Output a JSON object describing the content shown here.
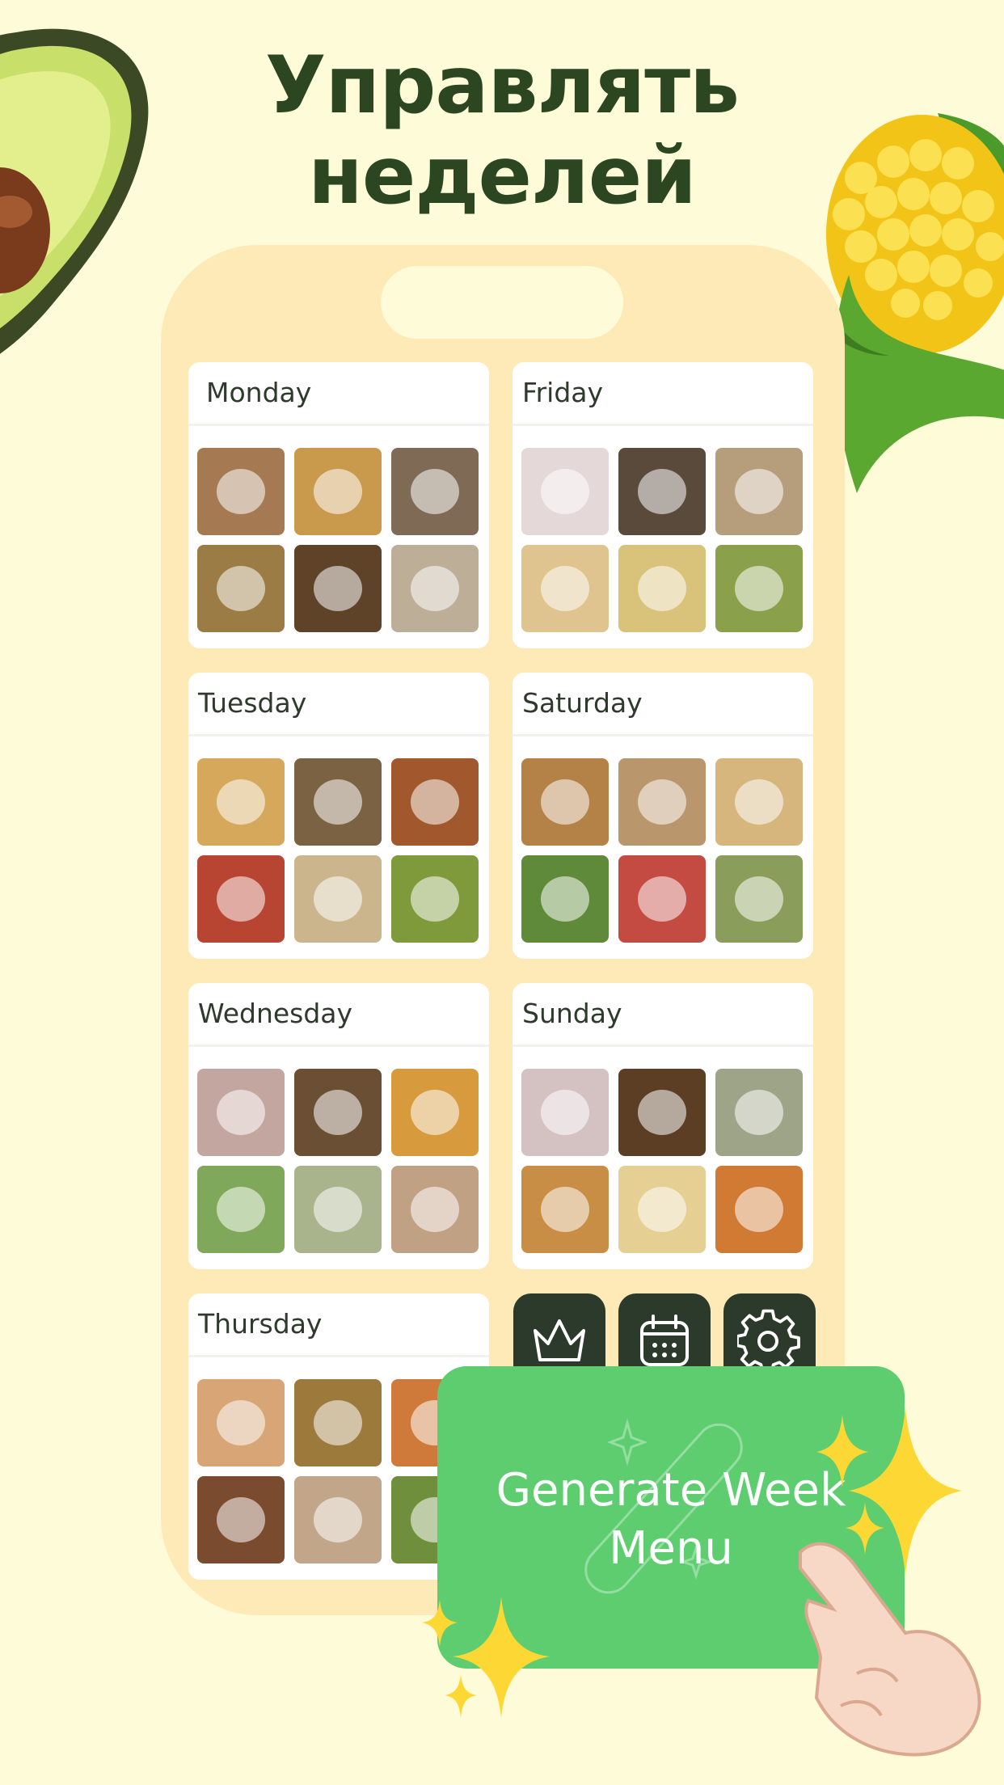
{
  "headline": {
    "line1": "Управлять",
    "line2": "неделей"
  },
  "days": [
    {
      "name": "Monday",
      "photos": [
        "#a57a52",
        "#c99a4c",
        "#7e6a55",
        "#9c7c45",
        "#5e4329",
        "#bcae97"
      ]
    },
    {
      "name": "Tuesday",
      "photos": [
        "#d6a85c",
        "#7a6242",
        "#a0582c",
        "#b84531",
        "#cbb58d",
        "#7f9a3a"
      ]
    },
    {
      "name": "Wednesday",
      "photos": [
        "#c3a6a0",
        "#6b4f34",
        "#d79a3c",
        "#7fa85a",
        "#a9b48c",
        "#c0a184"
      ]
    },
    {
      "name": "Thursday",
      "photos": [
        "#d7a576",
        "#9b7a3c",
        "#cf7a3b",
        "#7b4b2f",
        "#c1a68a",
        "#6f8f3d"
      ]
    },
    {
      "name": "Friday",
      "photos": [
        "#e4d8d8",
        "#5a4a3c",
        "#b69e7c",
        "#e0c48f",
        "#d9c27a",
        "#8aa04a"
      ]
    },
    {
      "name": "Saturday",
      "photos": [
        "#b48247",
        "#b9966b",
        "#d6b67c",
        "#5f8a3a",
        "#c44b42",
        "#8a9d5a"
      ]
    },
    {
      "name": "Sunday",
      "photos": [
        "#d4c2c3",
        "#5c3e25",
        "#9ea487",
        "#c88e45",
        "#e5cf93",
        "#d07a34"
      ]
    },
    {
      "name": "",
      "photos": []
    }
  ],
  "toolbar": {
    "icons": [
      "crown-icon",
      "calendar-icon",
      "gear-icon"
    ]
  },
  "cta": {
    "label": "Generate Week Menu"
  },
  "colors": {
    "background": "#fdfbd8",
    "phone": "#feeab7",
    "accent": "#5dcd70",
    "dark": "#2b3a2a",
    "headline": "#2b4621"
  }
}
